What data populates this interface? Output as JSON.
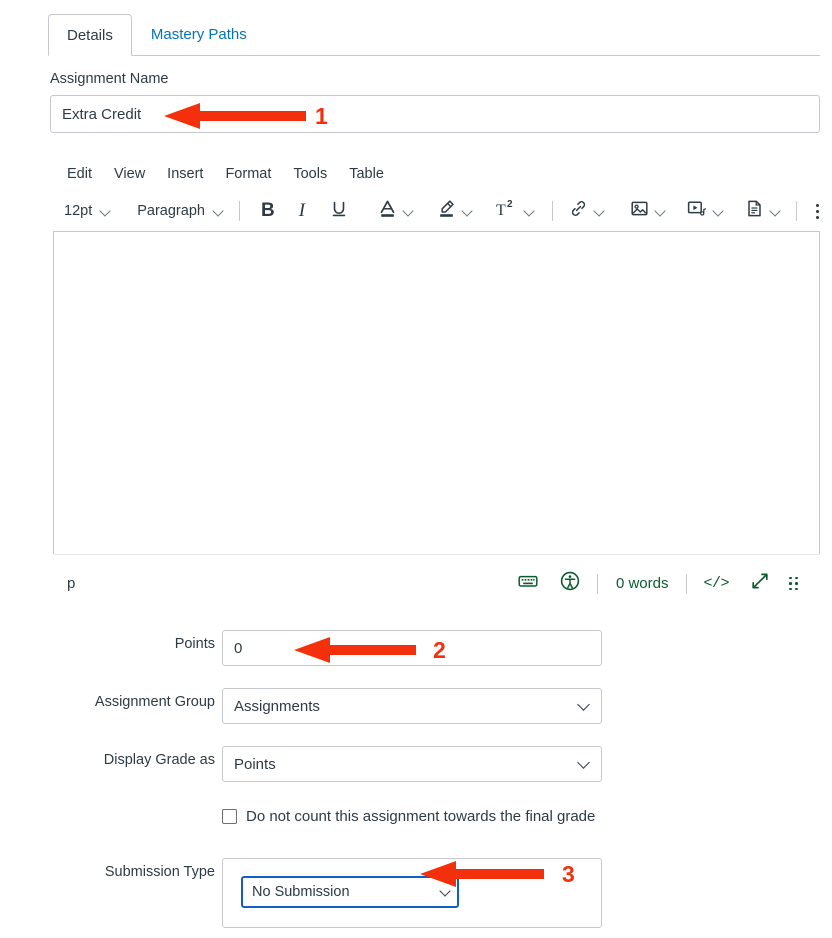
{
  "tabs": [
    {
      "label": "Details",
      "active": true
    },
    {
      "label": "Mastery Paths",
      "active": false
    }
  ],
  "assignment_name": {
    "label": "Assignment Name",
    "value": "Extra Credit"
  },
  "editor": {
    "menubar": [
      "Edit",
      "View",
      "Insert",
      "Format",
      "Tools",
      "Table"
    ],
    "toolbar": {
      "font_size": "12pt",
      "block_format": "Paragraph",
      "bold": "B",
      "italic": "I",
      "underline": "U",
      "superscript": "T2"
    },
    "content": "",
    "status": {
      "element_path": "p",
      "word_count": "0 words",
      "html_editor": "</>"
    }
  },
  "form": {
    "points": {
      "label": "Points",
      "value": "0"
    },
    "assignment_group": {
      "label": "Assignment Group",
      "value": "Assignments",
      "options": [
        "Assignments"
      ]
    },
    "display_grade_as": {
      "label": "Display Grade as",
      "value": "Points",
      "options": [
        "Points"
      ]
    },
    "omit_from_final": {
      "label": "Do not count this assignment towards the final grade",
      "checked": false
    },
    "submission_type": {
      "label": "Submission Type",
      "value": "No Submission",
      "options": [
        "No Submission"
      ]
    }
  },
  "annotations": [
    {
      "number": "1"
    },
    {
      "number": "2"
    },
    {
      "number": "3"
    }
  ],
  "colors": {
    "link": "#0374b5",
    "text": "#2d3b45",
    "border": "#c7c9d1",
    "annotation": "#f4300c",
    "focus": "#1060c8",
    "status_green": "#0b5c2e"
  }
}
